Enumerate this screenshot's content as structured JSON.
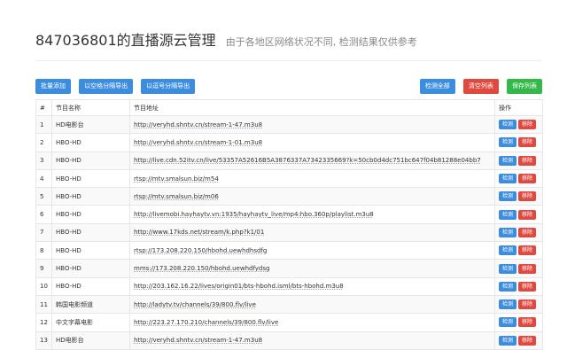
{
  "header": {
    "title": "847036801的直播源云管理",
    "subtitle": "由于各地区网络状况不同, 检测结果仅供参考"
  },
  "toolbar": {
    "batch_add": "批量添加",
    "export_space": "以空格分隔导出",
    "export_comma": "以逗号分隔导出",
    "check_all": "检测全部",
    "clear_list": "清空列表",
    "save_list": "保存列表"
  },
  "colors": {
    "blue": "#3c8dde",
    "red": "#e0493f",
    "green": "#35b84a"
  },
  "table": {
    "headers": [
      "#",
      "节目名称",
      "节目地址",
      "操作"
    ],
    "action_check": "检测",
    "action_remove": "移除",
    "rows": [
      {
        "num": "1",
        "name": "HD电影台",
        "url": "http://veryhd.shntv.cn/stream-1-47.m3u8"
      },
      {
        "num": "2",
        "name": "HBO-HD",
        "url": "http://veryhd.shntv.cn/stream-1-01.m3u8"
      },
      {
        "num": "3",
        "name": "HBO-HD",
        "url": "http://live.cdn.52itv.cn/live/53357A52616B5A3876337A7342335669?k=50cb0d4dc751bc647f04b81288e04bb7"
      },
      {
        "num": "4",
        "name": "HBO-HD",
        "url": "rtsp://mtv.smalsun.biz/m54"
      },
      {
        "num": "5",
        "name": "HBO-HD",
        "url": "rtsp://mtv.smalsun.biz/m06"
      },
      {
        "num": "6",
        "name": "HBO-HD",
        "url": "http://livemobi.hayhaytv.vn:1935/hayhaytv_live/mp4:hbo.360p/playlist.m3u8"
      },
      {
        "num": "7",
        "name": "HBO-HD",
        "url": "http://www.17kds.net/stream/k.php?k1/01"
      },
      {
        "num": "8",
        "name": "HBO-HD",
        "url": "rtsp://173.208.220.150/hbohd.uewhdhsdfg"
      },
      {
        "num": "9",
        "name": "HBO-HD",
        "url": "mms://173.208.220.150/hbohd.uewhdfydsg"
      },
      {
        "num": "10",
        "name": "HBO-HD",
        "url": "http://203.162.16.22/lives/origin01/bts-hbohd.isml/bts-hbohd.m3u8"
      },
      {
        "num": "11",
        "name": "韩国电影频道",
        "url": "http://ladytv.tv/channels/39/800.flv/live"
      },
      {
        "num": "12",
        "name": "中文字幕电影",
        "url": "http://223.27.170.210/channels/39/800.flv/live"
      },
      {
        "num": "13",
        "name": "HD电影台",
        "url": "http://veryhd.shntv.cn/stream-1-47.m3u8"
      }
    ]
  }
}
